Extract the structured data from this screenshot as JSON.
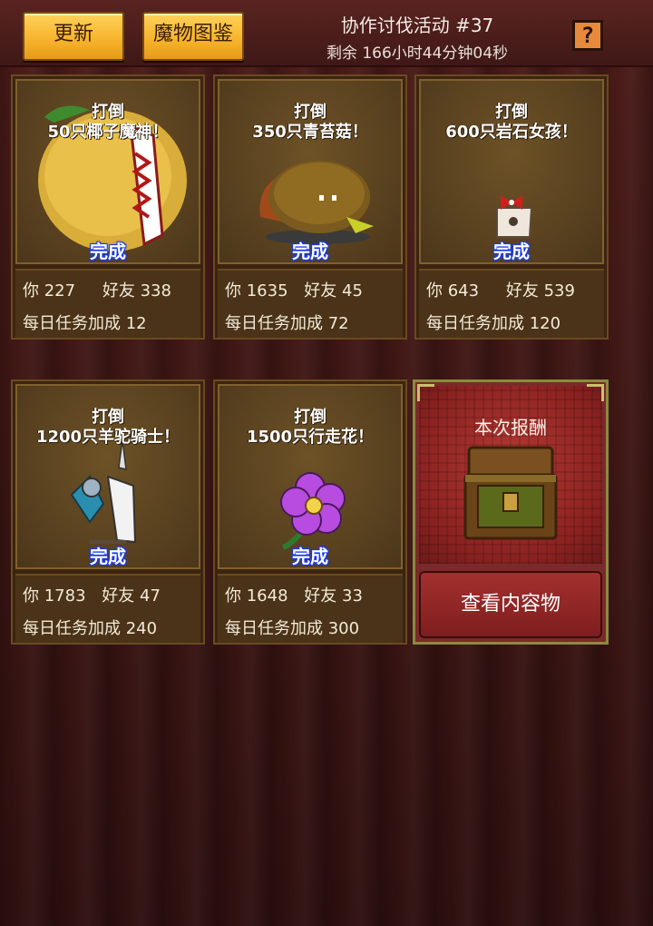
{
  "topbar": {
    "update_label": "更新",
    "bestiary_label": "魔物图鉴",
    "event_title": "协作讨伐活动 #37",
    "remaining": "剩余 166小时44分钟04秒",
    "help_symbol": "?"
  },
  "cards": [
    {
      "goal_line1": "打倒",
      "goal_line2": "50只椰子魔神！",
      "status": "完成",
      "you_label": "你",
      "you_value": "227",
      "friend_label": "好友",
      "friend_value": "338",
      "bonus_label": "每日任务加成",
      "bonus_value": "12",
      "monster_icon": "coconut-demon-icon"
    },
    {
      "goal_line1": "打倒",
      "goal_line2": "350只青苔菇！",
      "status": "完成",
      "you_label": "你",
      "you_value": "1635",
      "friend_label": "好友",
      "friend_value": "45",
      "bonus_label": "每日任务加成",
      "bonus_value": "72",
      "monster_icon": "moss-mushroom-icon"
    },
    {
      "goal_line1": "打倒",
      "goal_line2": "600只岩石女孩！",
      "status": "完成",
      "you_label": "你",
      "you_value": "643",
      "friend_label": "好友",
      "friend_value": "539",
      "bonus_label": "每日任务加成",
      "bonus_value": "120",
      "monster_icon": "rock-girl-icon"
    },
    {
      "goal_line1": "打倒",
      "goal_line2": "1200只羊驼骑士！",
      "status": "完成",
      "you_label": "你",
      "you_value": "1783",
      "friend_label": "好友",
      "friend_value": "47",
      "bonus_label": "每日任务加成",
      "bonus_value": "240",
      "monster_icon": "alpaca-knight-icon"
    },
    {
      "goal_line1": "打倒",
      "goal_line2": "1500只行走花！",
      "status": "完成",
      "you_label": "你",
      "you_value": "1648",
      "friend_label": "好友",
      "friend_value": "33",
      "bonus_label": "每日任务加成",
      "bonus_value": "300",
      "monster_icon": "walking-flower-icon"
    }
  ],
  "reward": {
    "title": "本次报酬",
    "view_button": "查看内容物",
    "icon": "treasure-chest-icon"
  },
  "colors": {
    "button_yellow": "#f7b22a",
    "done_blue": "#1636d8",
    "reward_red": "#8a2220"
  }
}
